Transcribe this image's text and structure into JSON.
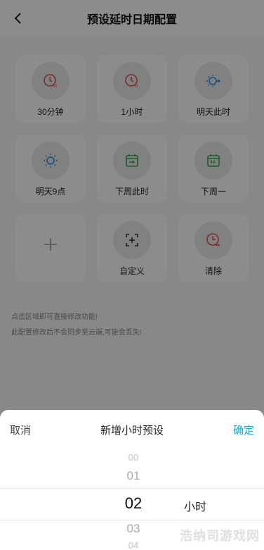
{
  "header": {
    "title": "预设延时日期配置"
  },
  "presets": [
    {
      "label": "30分钟",
      "icon": "clock-m-icon"
    },
    {
      "label": "1小时",
      "icon": "clock-h-icon"
    },
    {
      "label": "明天此时",
      "icon": "sun-arrow-icon"
    },
    {
      "label": "明天9点",
      "icon": "sun-icon"
    },
    {
      "label": "下周此时",
      "icon": "calendar-arrow-icon"
    },
    {
      "label": "下周一",
      "icon": "calendar-next-icon"
    },
    {
      "label": "",
      "icon": "plus-icon"
    },
    {
      "label": "自定义",
      "icon": "custom-add-icon"
    },
    {
      "label": "清除",
      "icon": "clock-clear-icon"
    }
  ],
  "notes": [
    "点击区域即可直接修改功能!",
    "此配置修改后不会同步至云端,可能会丢失!"
  ],
  "sheet": {
    "cancel": "取消",
    "title": "新增小时预设",
    "confirm": "确定",
    "options": [
      "00",
      "01",
      "02",
      "03",
      "04"
    ],
    "selected": "02",
    "unit": "小时"
  },
  "colors": {
    "accent": "#1aa7d9",
    "red": "#e0524d",
    "blue": "#2f8ee6",
    "green": "#3fa64b"
  },
  "watermark": "浩纳司游戏网"
}
